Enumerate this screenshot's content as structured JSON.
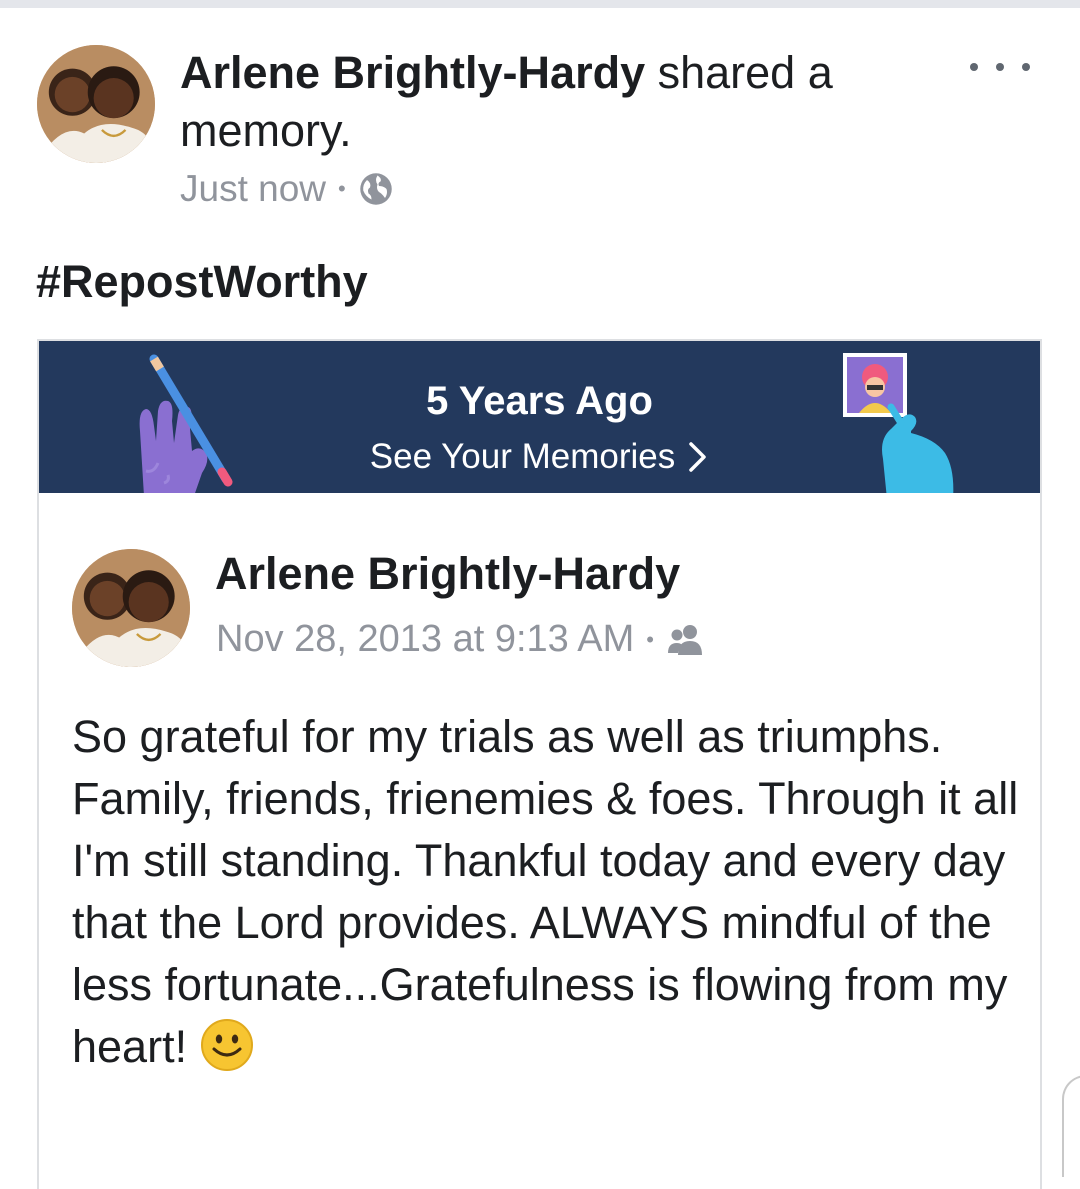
{
  "post": {
    "author": "Arlene Brightly-Hardy",
    "action": " shared a memory.",
    "timestamp": "Just now",
    "privacy_icon": "globe-icon",
    "more_icon": "more-horizontal-icon"
  },
  "hashtag": "#RepostWorthy",
  "memory_banner": {
    "title": "5 Years Ago",
    "link_label": "See Your Memories",
    "link_icon": "chevron-right-icon",
    "background_color": "#23395d"
  },
  "original_post": {
    "author": "Arlene Brightly-Hardy",
    "timestamp": "Nov 28, 2013 at 9:13 AM",
    "audience_icon": "friends-icon",
    "body": "So grateful for my trials as well as triumphs. Family, friends, frienemies & foes. Through it all I'm still standing.  Thankful today and every day that the Lord provides. ALWAYS mindful of the less fortunate...Gratefulness is flowing from my heart!",
    "emoji_icon": "smiley-emoji-icon"
  },
  "colors": {
    "text_primary": "#1c1e21",
    "text_secondary": "#90949c",
    "banner": "#23395d"
  }
}
